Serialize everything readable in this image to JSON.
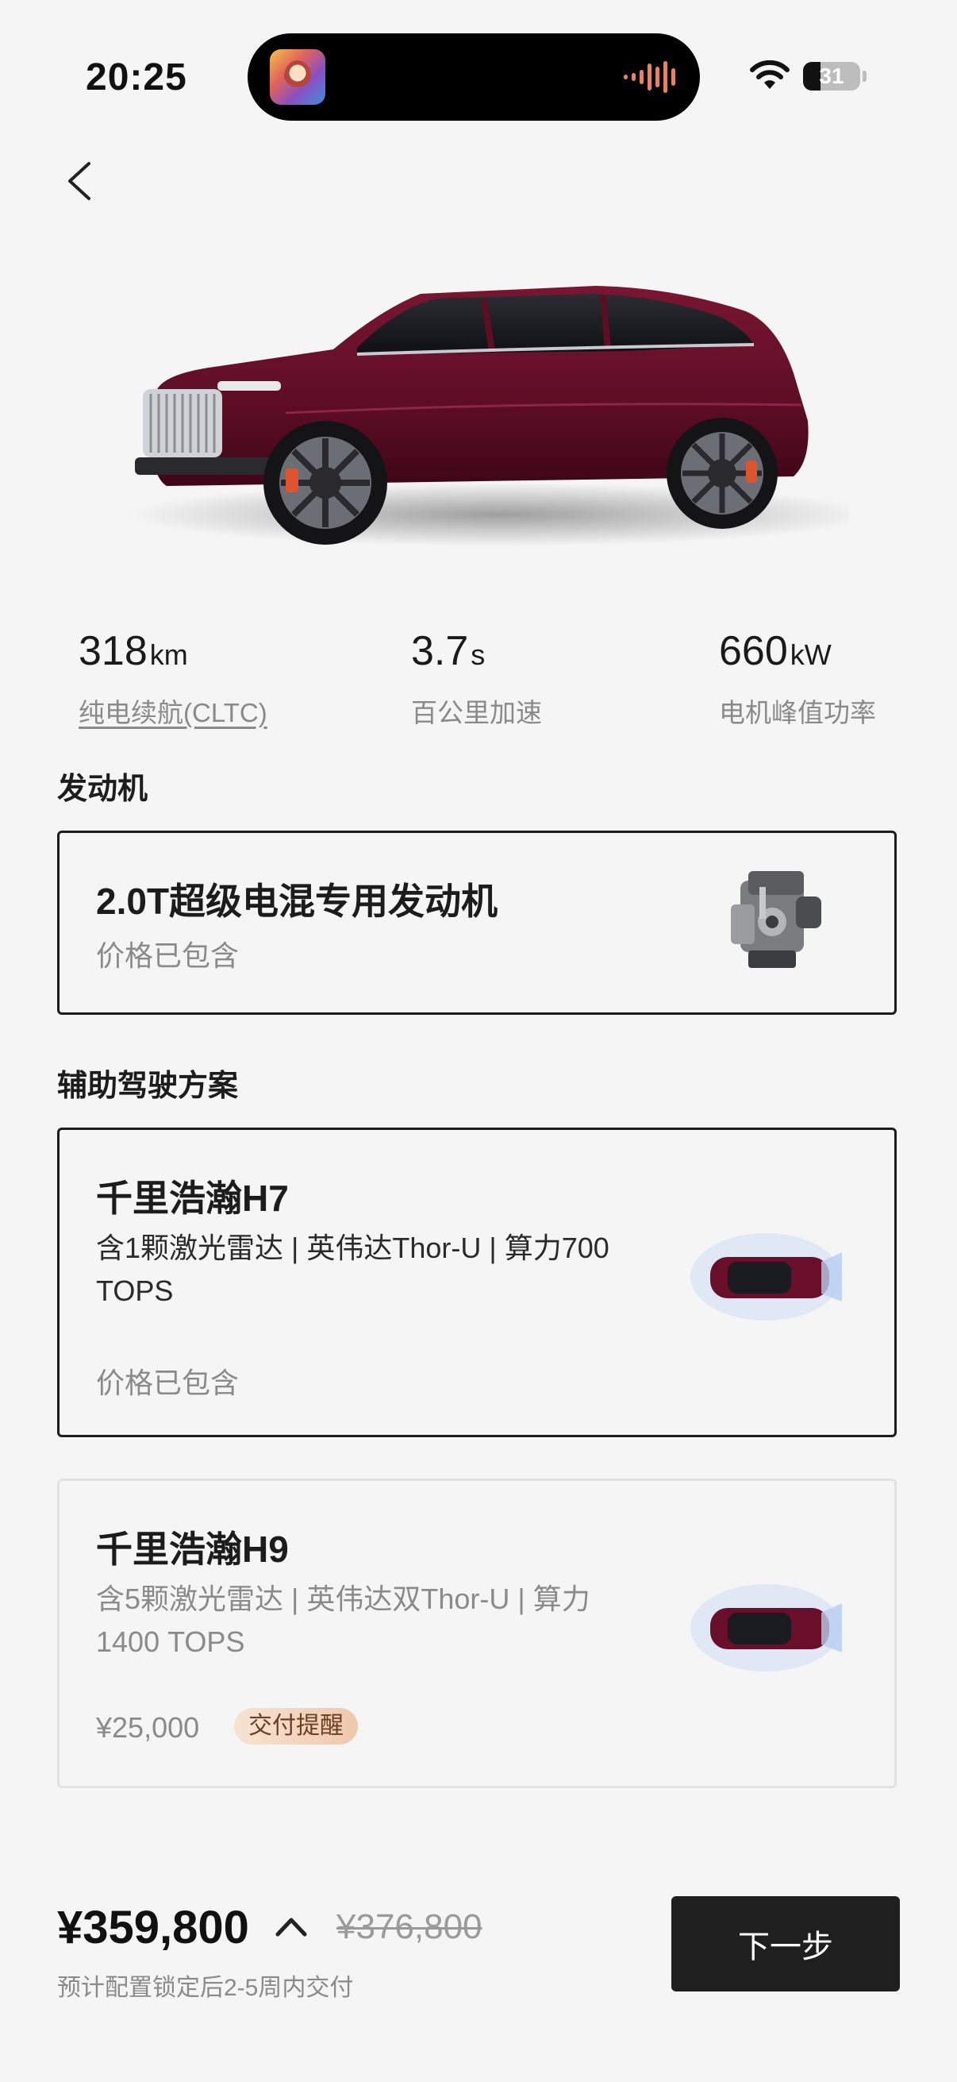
{
  "status_bar": {
    "time": "20:25",
    "battery": "31",
    "battery_level_percent": 31,
    "battery_fill_color": "#111111"
  },
  "header": {
    "back_icon": "chevron-left-icon"
  },
  "hero": {
    "image": "car-side-view",
    "car_color": "#6a0f2a"
  },
  "specs": [
    {
      "value": "318",
      "unit": "km",
      "label": "纯电续航(CLTC)"
    },
    {
      "value": "3.7",
      "unit": "s",
      "label": "百公里加速"
    },
    {
      "value": "660",
      "unit": "kW",
      "label": "电机峰值功率"
    }
  ],
  "engine": {
    "section_title": "发动机",
    "card": {
      "title": "2.0T超级电混专用发动机",
      "price": "价格已包含",
      "selected": true,
      "image": "engine-image"
    }
  },
  "adas": {
    "section_title": "辅助驾驶方案",
    "options": [
      {
        "title": "千里浩瀚H7",
        "desc": "含1颗激光雷达 | 英伟达Thor-U | 算力700 TOPS",
        "price": "价格已包含",
        "selected": true,
        "image": "car-top-view"
      },
      {
        "title": "千里浩瀚H9",
        "desc": "含5颗激光雷达 | 英伟达双Thor-U | 算力1400 TOPS",
        "price": "¥25,000",
        "badge": "交付提醒",
        "selected": false,
        "image": "car-top-view"
      }
    ]
  },
  "footer": {
    "total_price": "¥359,800",
    "original_price": "¥376,800",
    "delivery_note": "预计配置锁定后2-5周内交付",
    "next_label": "下一步"
  },
  "colors": {
    "accent_dark": "#1f1f1f",
    "muted_text": "#8a8a8a",
    "badge_bg": "#efc8ad"
  }
}
